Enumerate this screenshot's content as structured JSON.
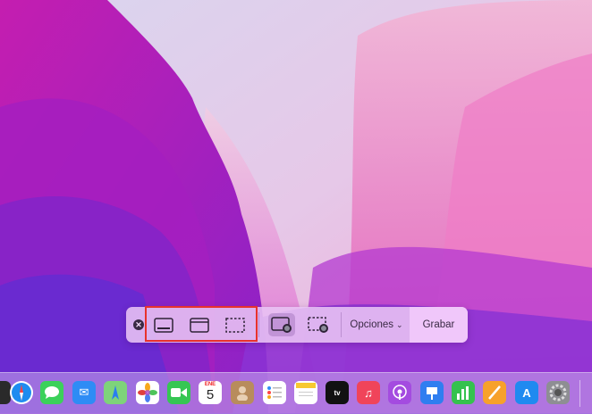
{
  "toolbar": {
    "close_glyph": "✕",
    "options_label": "Opciones",
    "options_chevron": "⌄",
    "record_label": "Grabar"
  },
  "dock": {
    "calendar_month": "ENE",
    "calendar_day": "5",
    "appletv_label": "tv",
    "music_glyph": "♫",
    "appstore_glyph": "A",
    "mail_glyph": "✉"
  }
}
